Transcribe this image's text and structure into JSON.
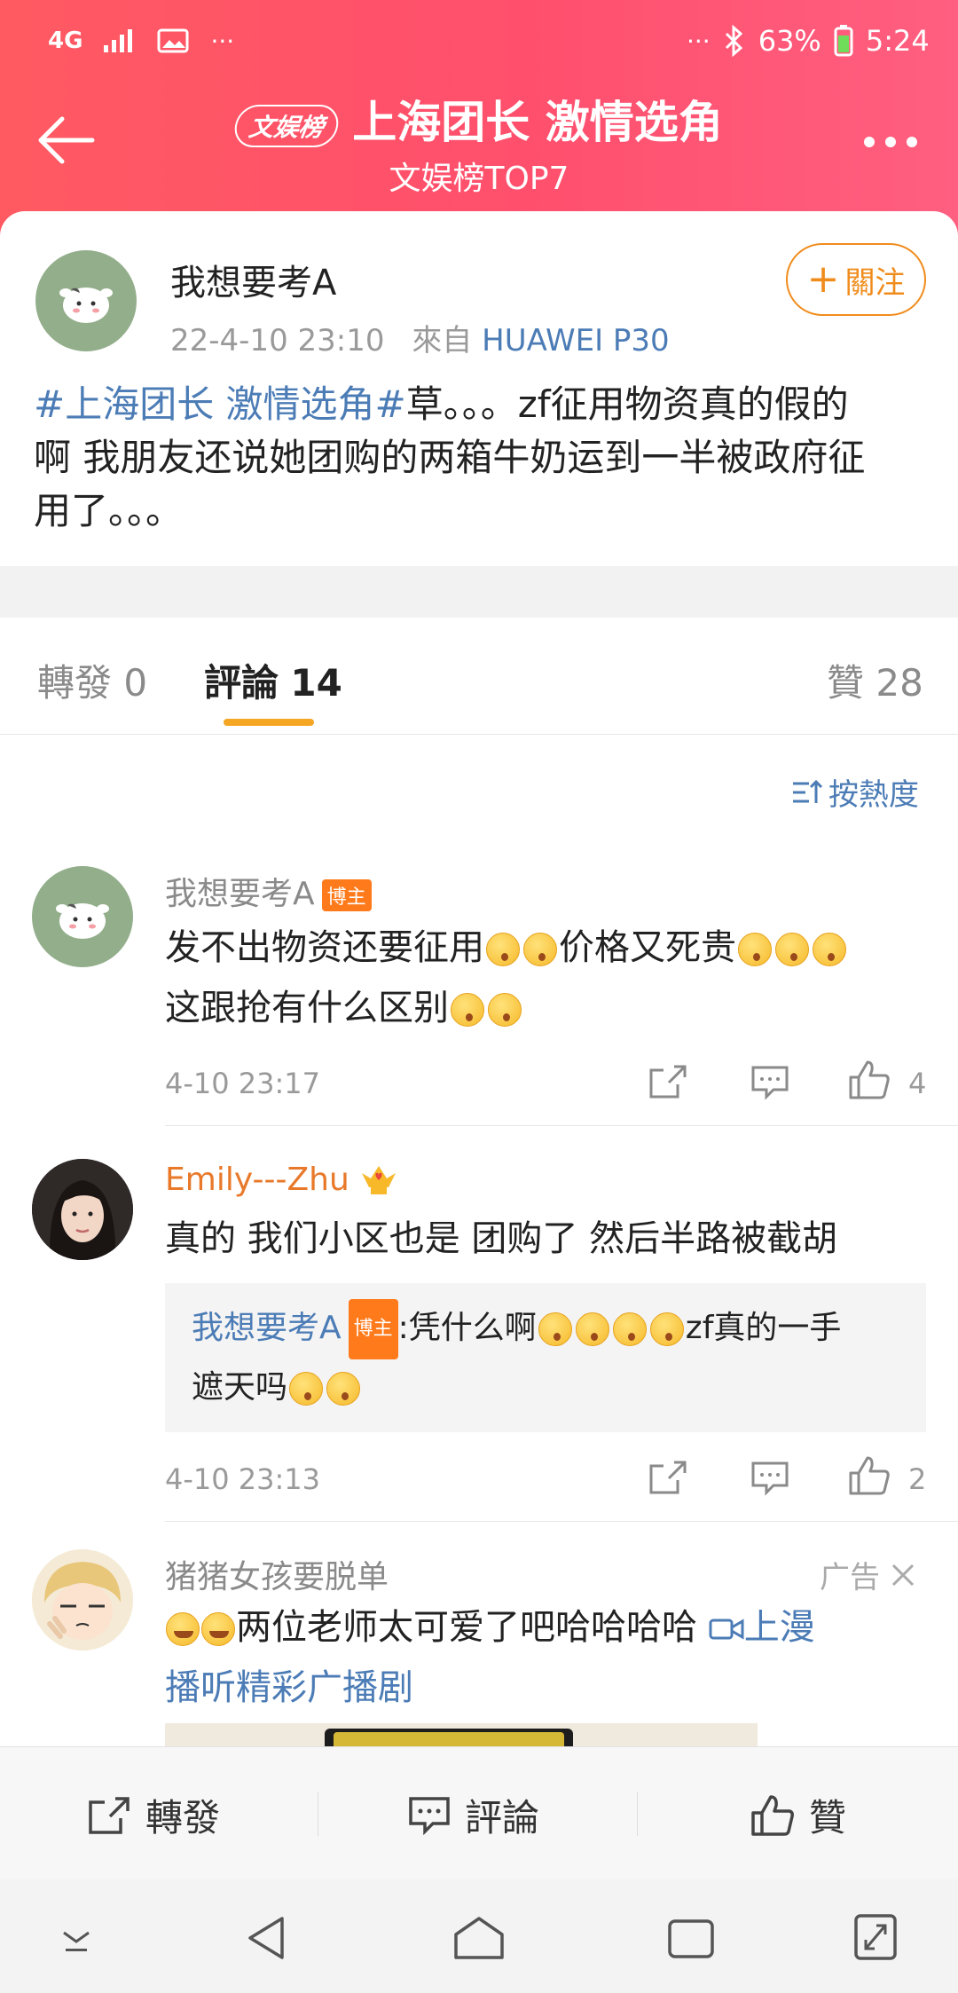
{
  "status_bar": {
    "network": "4G",
    "battery": "63%",
    "time": "5:24"
  },
  "nav": {
    "badge": "文娱榜",
    "title": "上海团长 激情选角",
    "subtitle": "文娱榜TOP7"
  },
  "post": {
    "author": "我想要考A",
    "date": "22-4-10 23:10",
    "source_prefix": "來自",
    "source": "HUAWEI P30",
    "follow_label": "關注",
    "hashtag": "#上海团长 激情选角#",
    "text_line1_rest": "草。。。zf征用物资真的假的",
    "text_line2": "啊 我朋友还说她团购的两箱牛奶运到一半被政府征",
    "text_line3": "用了。。。"
  },
  "tabs": {
    "repost": "轉發 0",
    "comments_label": "評論",
    "comments_count": "14",
    "likes": "贊 28"
  },
  "sort": {
    "label": "按熱度"
  },
  "comments": [
    {
      "name": "我想要考A",
      "badge": "博主",
      "line1": "发不出物资还要征用",
      "line1b": "价格又死贵",
      "line2": "这跟抢有什么区别",
      "time": "4-10 23:17",
      "likes": "4"
    },
    {
      "name": "Emily---Zhu",
      "text": "真的 我们小区也是 团购了 然后半路被截胡",
      "reply_name": "我想要考A",
      "reply_badge": "博主",
      "reply_text1": ":凭什么啊",
      "reply_text1b": "zf真的一手",
      "reply_text2": "遮天吗",
      "time": "4-10 23:13",
      "likes": "2"
    },
    {
      "name": "猪猪女孩要脱单",
      "ad_label": "广告",
      "text1": "两位老师太可爱了吧哈哈哈哈",
      "link1": "上漫",
      "link2": "播听精彩广播剧"
    }
  ],
  "bottom_bar": {
    "repost": "轉發",
    "comment": "評論",
    "like": "贊"
  },
  "colors": {
    "header": "#ff5a62",
    "accent": "#f08c1c",
    "link": "#4c7cb6",
    "tab_underline": "#f5a623"
  }
}
